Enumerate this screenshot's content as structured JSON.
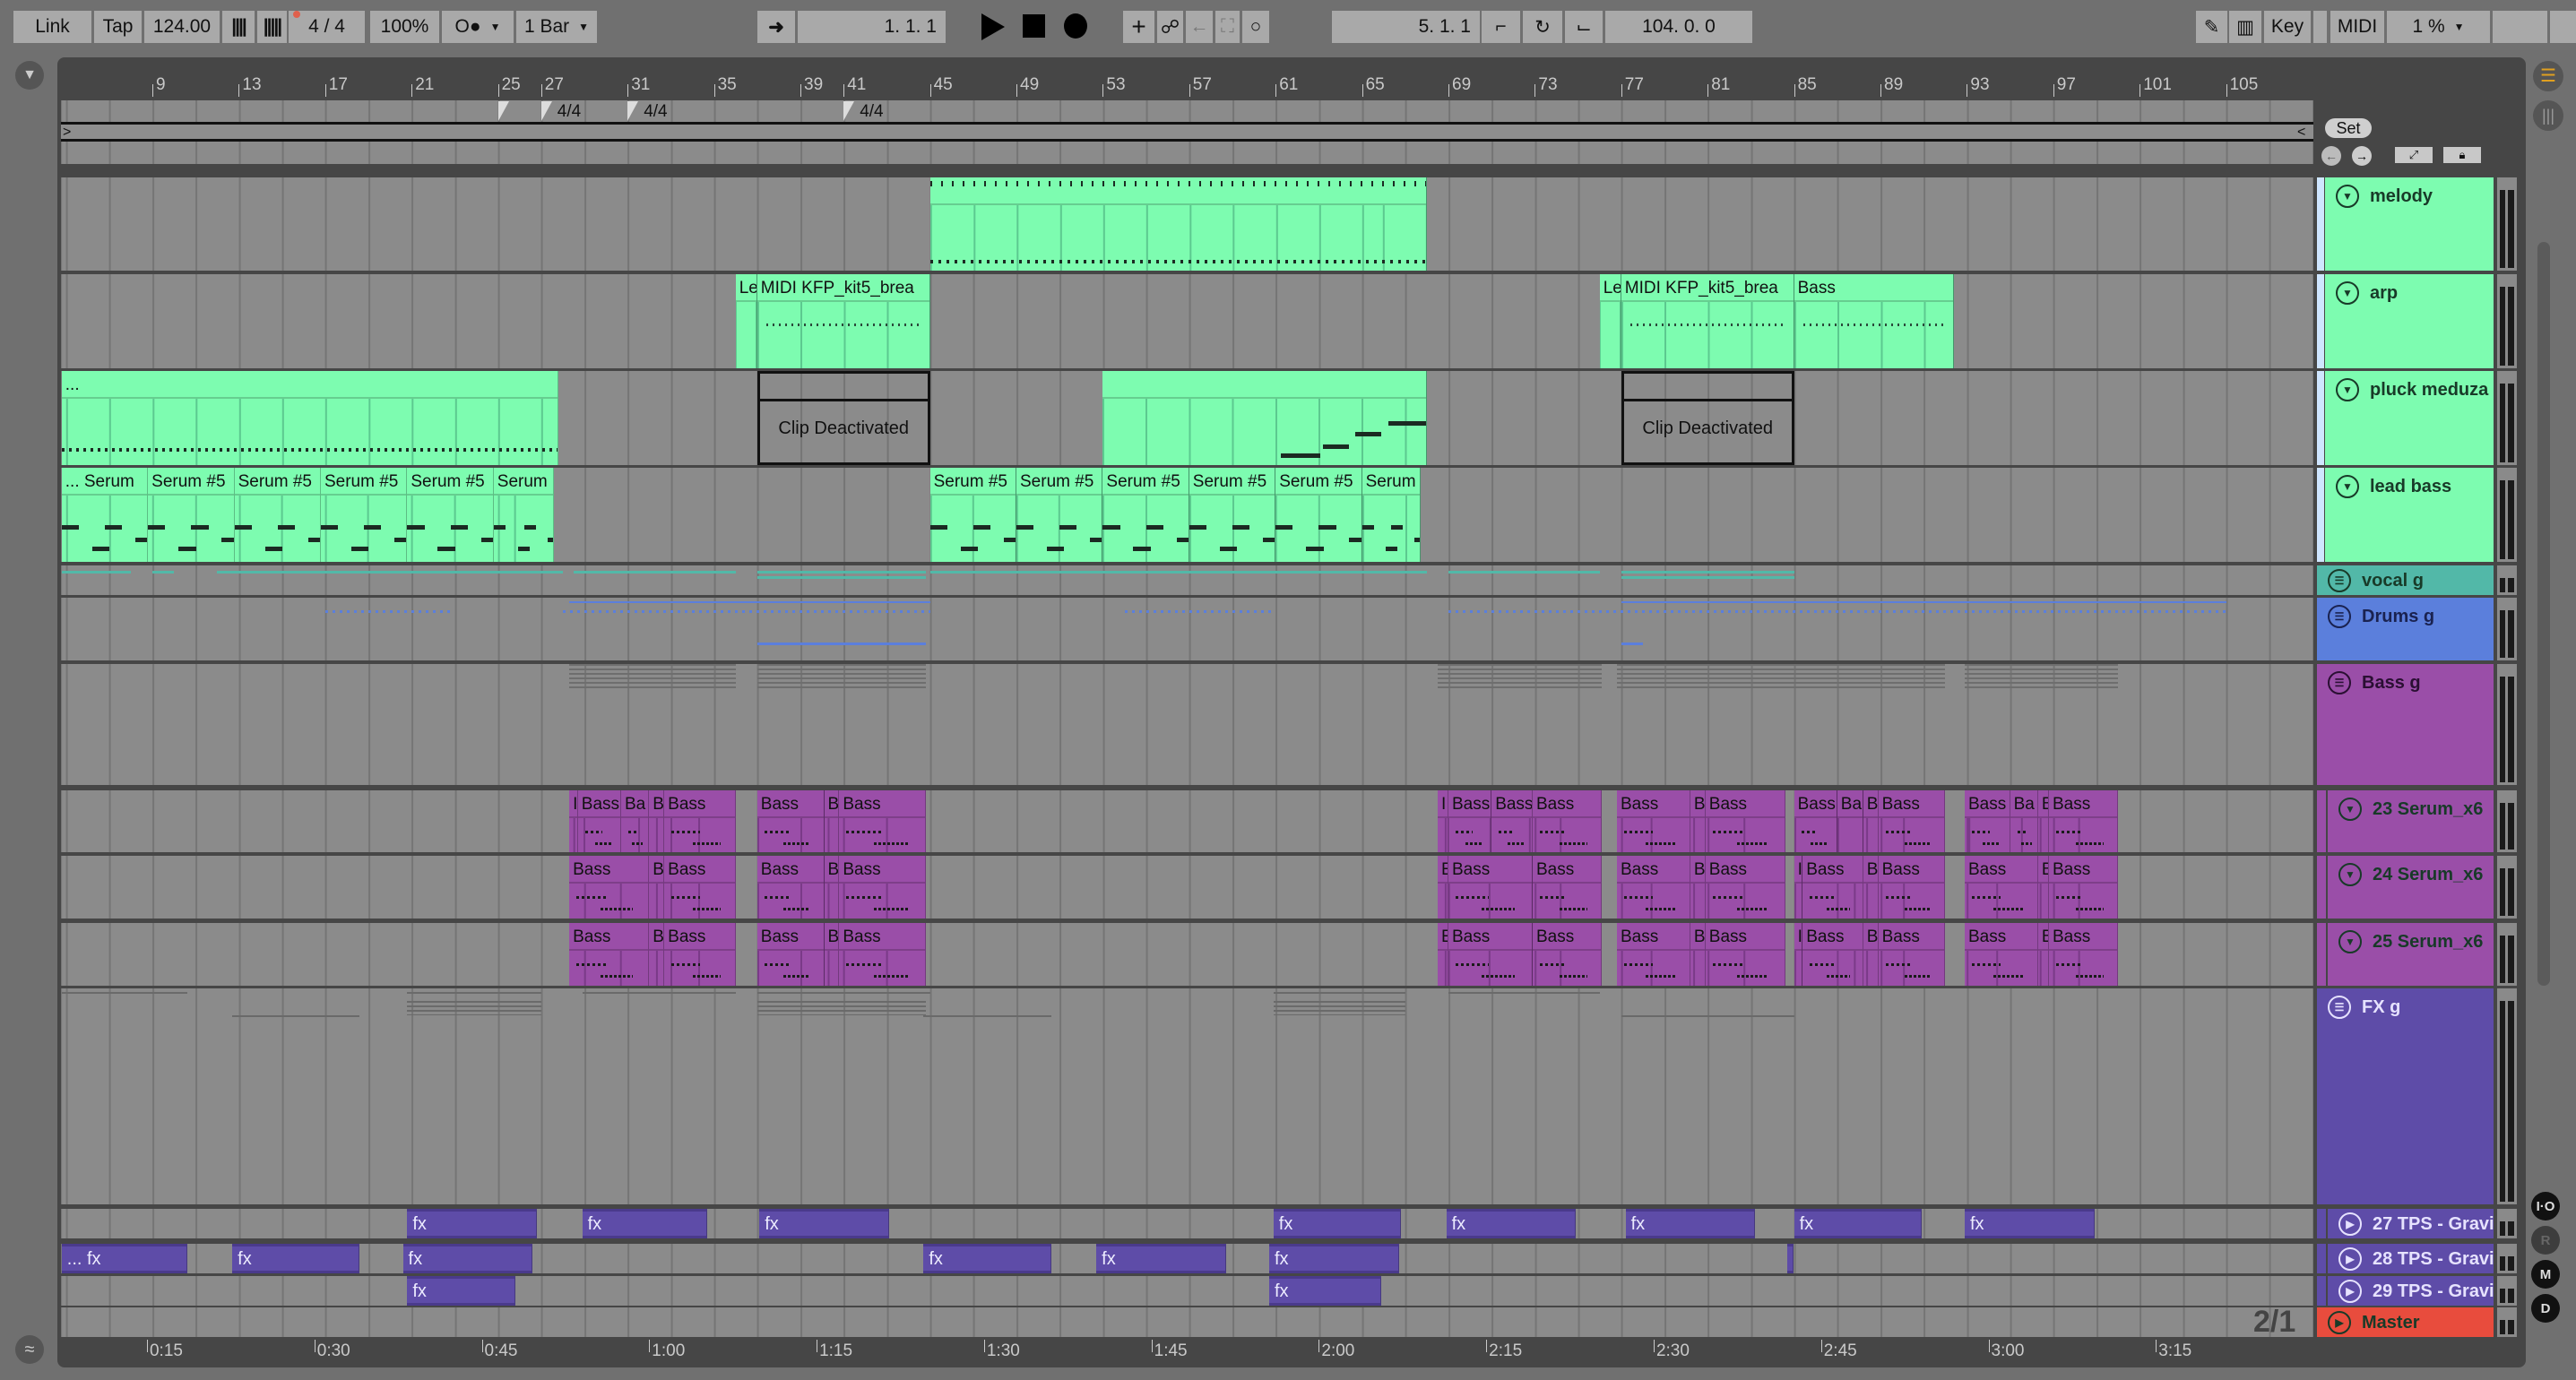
{
  "toolbar": {
    "link": "Link",
    "tap": "Tap",
    "tempo": "124.00",
    "time_signature": "4 / 4",
    "zoom": "100%",
    "metro_label": "O●",
    "quantize": "1 Bar",
    "arrangement_position": "1.  1.  1",
    "loop_start": "5.  1.  1",
    "loop_length": "104.  0.  0",
    "key": "Key",
    "midi": "MIDI",
    "cpu": "1 %"
  },
  "ruler": {
    "bars": [
      9,
      13,
      17,
      21,
      25,
      27,
      31,
      35,
      39,
      41,
      45,
      49,
      53,
      57,
      61,
      65,
      69,
      73,
      77,
      81,
      85,
      89,
      93,
      97,
      101,
      105
    ],
    "time_signatures": [
      {
        "bar": 25,
        "label": ""
      },
      {
        "bar": 27,
        "label": "4/4"
      },
      {
        "bar": 31,
        "label": "4/4"
      },
      {
        "bar": 41,
        "label": "4/4"
      }
    ]
  },
  "set_label": "Set",
  "tempo_bpm": 124,
  "timeline": {
    "labels": [
      "0:15",
      "0:30",
      "0:45",
      "1:00",
      "1:15",
      "1:30",
      "1:45",
      "2:00",
      "2:15",
      "2:30",
      "2:45",
      "3:00",
      "3:15"
    ],
    "seconds": [
      15,
      30,
      45,
      60,
      75,
      90,
      105,
      120,
      135,
      150,
      165,
      180,
      195
    ]
  },
  "page_indicator": "2/1",
  "side_buttons": [
    "I·O",
    "R",
    "M",
    "D"
  ],
  "colors": {
    "green": "#7dfcb0",
    "purple": "#9a4ea8",
    "fx": "#5e4ca8",
    "drums": "#5b7fdc",
    "vocal": "#52b8a8",
    "master": "#e84c3d"
  },
  "tracks": [
    {
      "name": "melody",
      "icon": "fold",
      "color": "#7dfcb0",
      "clips": [
        {
          "label": "",
          "start": 45,
          "end": 68,
          "type": "melody"
        }
      ]
    },
    {
      "name": "arp",
      "icon": "fold",
      "color": "#7dfcb0",
      "clips": [
        {
          "label": "Le",
          "start": 36,
          "end": 37
        },
        {
          "label": "MIDI KFP_kit5_brea",
          "start": 37,
          "end": 45
        },
        {
          "label": "Le",
          "start": 76,
          "end": 77
        },
        {
          "label": "MIDI KFP_kit5_brea",
          "start": 77,
          "end": 85
        },
        {
          "label": "Bass",
          "start": 85,
          "end": 92.4
        }
      ]
    },
    {
      "name": "pluck meduza",
      "icon": "fold",
      "color": "#7dfcb0",
      "clips": [
        {
          "label": "...",
          "start": 4.8,
          "end": 27.8
        },
        {
          "label": "Clip Deactivated",
          "start": 37,
          "end": 45,
          "type": "deactivated"
        },
        {
          "label": "",
          "start": 53,
          "end": 68
        },
        {
          "label": "Clip Deactivated",
          "start": 77,
          "end": 85,
          "type": "deactivated"
        }
      ]
    },
    {
      "name": "lead bass",
      "icon": "fold",
      "color": "#7dfcb0",
      "clips": [
        {
          "label": "... Serum",
          "start": 4.8,
          "end": 8.8
        },
        {
          "label": "Serum #5",
          "start": 8.8,
          "end": 12.8
        },
        {
          "label": "Serum #5",
          "start": 12.8,
          "end": 16.8
        },
        {
          "label": "Serum #5",
          "start": 16.8,
          "end": 20.8
        },
        {
          "label": "Serum #5",
          "start": 20.8,
          "end": 24.8
        },
        {
          "label": "Serum",
          "start": 24.8,
          "end": 27.6
        },
        {
          "label": "Serum #5",
          "start": 45,
          "end": 49
        },
        {
          "label": "Serum #5",
          "start": 49,
          "end": 53
        },
        {
          "label": "Serum #5",
          "start": 53,
          "end": 57
        },
        {
          "label": "Serum #5",
          "start": 57,
          "end": 61
        },
        {
          "label": "Serum #5",
          "start": 61,
          "end": 65
        },
        {
          "label": "Serum",
          "start": 65,
          "end": 67.7
        }
      ]
    },
    {
      "name": "vocal   g",
      "icon": "group",
      "color": "#52b8a8",
      "clips": []
    },
    {
      "name": "Drums g",
      "icon": "group",
      "color": "#5b7fdc",
      "clips": []
    },
    {
      "name": "Bass g",
      "icon": "group",
      "color": "#9a4ea8",
      "clips": []
    },
    {
      "name": "23 Serum_x6",
      "icon": "fold",
      "color": "#9a4ea8",
      "clips": [
        {
          "label": "I",
          "start": 28.3,
          "end": 28.7
        },
        {
          "label": "Bass",
          "start": 28.7,
          "end": 30.7
        },
        {
          "label": "Ba",
          "start": 30.7,
          "end": 32
        },
        {
          "label": "B",
          "start": 32,
          "end": 32.7
        },
        {
          "label": "Bass",
          "start": 32.7,
          "end": 36
        },
        {
          "label": "Bass",
          "start": 37,
          "end": 40.1
        },
        {
          "label": "B",
          "start": 40.1,
          "end": 40.8
        },
        {
          "label": "Bass",
          "start": 40.8,
          "end": 44.8
        },
        {
          "label": "I",
          "start": 68.5,
          "end": 69
        },
        {
          "label": "Bass",
          "start": 69,
          "end": 71
        },
        {
          "label": "Bass",
          "start": 71,
          "end": 72.9
        },
        {
          "label": "Bass",
          "start": 72.9,
          "end": 76.1
        },
        {
          "label": "Bass",
          "start": 76.8,
          "end": 80.2
        },
        {
          "label": "B",
          "start": 80.2,
          "end": 80.9
        },
        {
          "label": "Bass",
          "start": 80.9,
          "end": 84.6
        },
        {
          "label": "Bass",
          "start": 85,
          "end": 87
        },
        {
          "label": "Ba",
          "start": 87,
          "end": 88.2
        },
        {
          "label": "B",
          "start": 88.2,
          "end": 88.9
        },
        {
          "label": "Bass",
          "start": 88.9,
          "end": 92
        },
        {
          "label": "Bass",
          "start": 92.9,
          "end": 95
        },
        {
          "label": "Ba",
          "start": 95,
          "end": 96.3
        },
        {
          "label": "B",
          "start": 96.3,
          "end": 96.8
        },
        {
          "label": "Bass",
          "start": 96.8,
          "end": 100
        }
      ]
    },
    {
      "name": "24 Serum_x6",
      "icon": "fold",
      "color": "#9a4ea8",
      "clips": [
        {
          "label": "Bass",
          "start": 28.3,
          "end": 32
        },
        {
          "label": "B",
          "start": 32,
          "end": 32.7
        },
        {
          "label": "Bass",
          "start": 32.7,
          "end": 36
        },
        {
          "label": "Bass",
          "start": 37,
          "end": 40.1
        },
        {
          "label": "B",
          "start": 40.1,
          "end": 40.8
        },
        {
          "label": "Bass",
          "start": 40.8,
          "end": 44.8
        },
        {
          "label": "E",
          "start": 68.5,
          "end": 69
        },
        {
          "label": "Bass",
          "start": 69,
          "end": 72.9
        },
        {
          "label": "Bass",
          "start": 72.9,
          "end": 76.1
        },
        {
          "label": "Bass",
          "start": 76.8,
          "end": 80.2
        },
        {
          "label": "B",
          "start": 80.2,
          "end": 80.9
        },
        {
          "label": "Bass",
          "start": 80.9,
          "end": 84.6
        },
        {
          "label": "I",
          "start": 85,
          "end": 85.4
        },
        {
          "label": "Bass",
          "start": 85.4,
          "end": 88.2
        },
        {
          "label": "B",
          "start": 88.2,
          "end": 88.9
        },
        {
          "label": "Bass",
          "start": 88.9,
          "end": 92
        },
        {
          "label": "Bass",
          "start": 92.9,
          "end": 96.3
        },
        {
          "label": "B",
          "start": 96.3,
          "end": 96.8
        },
        {
          "label": "Bass",
          "start": 96.8,
          "end": 100
        }
      ]
    },
    {
      "name": "25 Serum_x6",
      "icon": "fold",
      "color": "#9a4ea8",
      "clips": [
        {
          "label": "Bass",
          "start": 28.3,
          "end": 32
        },
        {
          "label": "B",
          "start": 32,
          "end": 32.7
        },
        {
          "label": "Bass",
          "start": 32.7,
          "end": 36
        },
        {
          "label": "Bass",
          "start": 37,
          "end": 40.1
        },
        {
          "label": "B",
          "start": 40.1,
          "end": 40.8
        },
        {
          "label": "Bass",
          "start": 40.8,
          "end": 44.8
        },
        {
          "label": "E",
          "start": 68.5,
          "end": 69
        },
        {
          "label": "Bass",
          "start": 69,
          "end": 72.9
        },
        {
          "label": "Bass",
          "start": 72.9,
          "end": 76.1
        },
        {
          "label": "Bass",
          "start": 76.8,
          "end": 80.2
        },
        {
          "label": "B",
          "start": 80.2,
          "end": 80.9
        },
        {
          "label": "Bass",
          "start": 80.9,
          "end": 84.6
        },
        {
          "label": "I",
          "start": 85,
          "end": 85.4
        },
        {
          "label": "Bass",
          "start": 85.4,
          "end": 88.2
        },
        {
          "label": "B",
          "start": 88.2,
          "end": 88.9
        },
        {
          "label": "Bass",
          "start": 88.9,
          "end": 92
        },
        {
          "label": "Bass",
          "start": 92.9,
          "end": 96.3
        },
        {
          "label": "B",
          "start": 96.3,
          "end": 96.8
        },
        {
          "label": "Bass",
          "start": 96.8,
          "end": 100
        }
      ]
    },
    {
      "name": "FX g",
      "icon": "group",
      "color": "#5e4ca8",
      "clips": []
    },
    {
      "name": "27 TPS - Gravi",
      "icon": "play",
      "color": "#5e4ca8",
      "clips": [
        {
          "label": "fx",
          "start": 20.8,
          "end": 26.8
        },
        {
          "label": "fx",
          "start": 28.9,
          "end": 34.7
        },
        {
          "label": "fx",
          "start": 37.1,
          "end": 43.1
        },
        {
          "label": "fx",
          "start": 60.9,
          "end": 66.8
        },
        {
          "label": "fx",
          "start": 68.9,
          "end": 74.9
        },
        {
          "label": "fx",
          "start": 77.2,
          "end": 83.2
        },
        {
          "label": "fx",
          "start": 85,
          "end": 90.9
        },
        {
          "label": "fx",
          "start": 92.9,
          "end": 98.9
        }
      ]
    },
    {
      "name": "28 TPS - Gravi",
      "icon": "play",
      "color": "#5e4ca8",
      "clips": [
        {
          "label": "... fx",
          "start": 4.8,
          "end": 10.6
        },
        {
          "label": "fx",
          "start": 12.7,
          "end": 18.6
        },
        {
          "label": "fx",
          "start": 20.6,
          "end": 26.6
        },
        {
          "label": "fx",
          "start": 44.7,
          "end": 50.6
        },
        {
          "label": "fx",
          "start": 52.7,
          "end": 58.7
        },
        {
          "label": "fx",
          "start": 60.7,
          "end": 66.7
        },
        {
          "label": "",
          "start": 84.7,
          "end": 84.85
        }
      ]
    },
    {
      "name": "29 TPS - Gravi",
      "icon": "play",
      "color": "#5e4ca8",
      "clips": [
        {
          "label": "fx",
          "start": 20.8,
          "end": 25.8
        },
        {
          "label": "fx",
          "start": 60.7,
          "end": 65.9
        }
      ]
    },
    {
      "name": "Master",
      "icon": "play",
      "color": "#e84c3d",
      "clips": []
    }
  ]
}
